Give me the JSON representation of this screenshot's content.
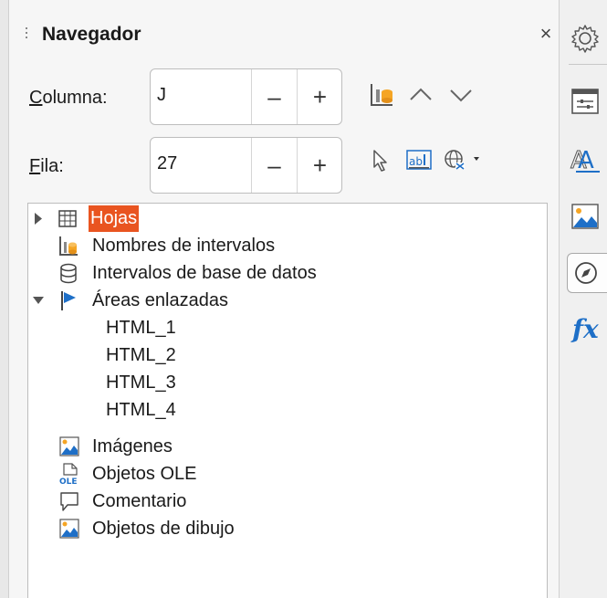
{
  "panel": {
    "title": "Navegador",
    "close_glyph": "×"
  },
  "controls": {
    "column_label_accel": "C",
    "column_label_rest": "olumna:",
    "column_value": "J",
    "row_label_accel": "F",
    "row_label_rest": "ila:",
    "row_value": "27",
    "minus_glyph": "–",
    "plus_glyph": "+"
  },
  "toolbar_icons": [
    "range-names-icon",
    "previous-chevron-icon",
    "next-chevron-icon",
    "drag-mode-pointer-icon",
    "contents-abl-icon",
    "document-globe-dropdown-icon"
  ],
  "tree": {
    "items": [
      {
        "label": "Hojas",
        "icon": "table-sheet-icon",
        "expandable": true,
        "expanded": false,
        "selected": true
      },
      {
        "label": "Nombres de intervalos",
        "icon": "range-names-icon"
      },
      {
        "label": "Intervalos de base de datos",
        "icon": "database-icon"
      },
      {
        "label": "Áreas enlazadas",
        "icon": "flag-icon",
        "expandable": true,
        "expanded": true
      },
      {
        "label": "HTML_1",
        "child": true
      },
      {
        "label": "HTML_2",
        "child": true
      },
      {
        "label": "HTML_3",
        "child": true
      },
      {
        "label": "HTML_4",
        "child": true
      },
      {
        "label": "Imágenes",
        "icon": "image-icon"
      },
      {
        "label": "Objetos OLE",
        "icon": "ole-object-icon"
      },
      {
        "label": "Comentario",
        "icon": "comment-icon"
      },
      {
        "label": "Objetos de dibujo",
        "icon": "drawing-image-icon"
      }
    ]
  },
  "sidebar": {
    "items": [
      "properties-gear-icon",
      "page-settings-icon",
      "styles-icon",
      "gallery-icon",
      "navigator-compass-icon",
      "functions-fx-icon"
    ],
    "fx_label": "fx"
  },
  "colors": {
    "selection": "#e95420",
    "accent_blue": "#1e6fc7",
    "folder_orange": "#f5a524"
  }
}
